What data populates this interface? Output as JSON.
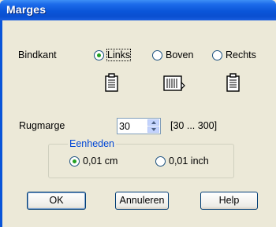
{
  "window": {
    "title": "Marges"
  },
  "binding": {
    "label": "Bindkant",
    "options": [
      {
        "label": "Links",
        "selected": true,
        "icon": "document-left-binding-icon"
      },
      {
        "label": "Boven",
        "selected": false,
        "icon": "document-top-binding-icon"
      },
      {
        "label": "Rechts",
        "selected": false,
        "icon": "document-right-binding-icon"
      }
    ]
  },
  "gutter": {
    "label": "Rugmarge",
    "value": "30",
    "range": "[30 ... 300]"
  },
  "units": {
    "legend": "Eenheden",
    "options": [
      {
        "label": "0,01 cm",
        "selected": true
      },
      {
        "label": "0,01 inch",
        "selected": false
      }
    ]
  },
  "buttons": {
    "ok": "OK",
    "cancel": "Annuleren",
    "help": "Help"
  },
  "colors": {
    "titlebar": "#0a55d9",
    "dialog_bg": "#ece9d8",
    "radio_dot": "#21a121",
    "legend_text": "#0046d5"
  }
}
